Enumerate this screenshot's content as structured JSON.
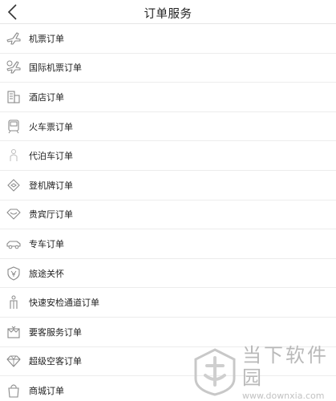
{
  "header": {
    "title": "订单服务",
    "back_icon": "chevron-left-icon"
  },
  "menu": {
    "items": [
      {
        "label": "机票订单",
        "icon": "airplane-icon"
      },
      {
        "label": "国际机票订单",
        "icon": "international-flight-icon"
      },
      {
        "label": "酒店订单",
        "icon": "hotel-icon"
      },
      {
        "label": "火车票订单",
        "icon": "train-icon"
      },
      {
        "label": "代泊车订单",
        "icon": "valet-parking-icon"
      },
      {
        "label": "登机牌订单",
        "icon": "boarding-pass-icon"
      },
      {
        "label": "贵宾厅订单",
        "icon": "vip-lounge-icon"
      },
      {
        "label": "专车订单",
        "icon": "car-icon"
      },
      {
        "label": "旅途关怀",
        "icon": "shield-icon"
      },
      {
        "label": "快速安检通道订单",
        "icon": "security-check-icon"
      },
      {
        "label": "要客服务订单",
        "icon": "vip-service-icon"
      },
      {
        "label": "超级空客订单",
        "icon": "diamond-icon"
      },
      {
        "label": "商城订单",
        "icon": "shopping-bag-icon"
      }
    ]
  },
  "watermark": {
    "name": "当下软件园",
    "url": "www.downxia.com"
  },
  "colors": {
    "text": "#222222",
    "icon": "#8a8a8a",
    "divider": "#ececec",
    "watermark": "#b9b9b9"
  }
}
